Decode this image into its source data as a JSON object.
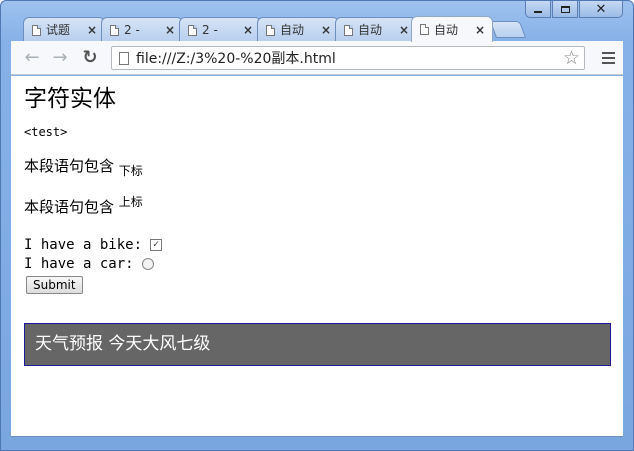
{
  "tabs": [
    {
      "title": "试题",
      "active": false
    },
    {
      "title": "2 - ",
      "active": false
    },
    {
      "title": "2 - ",
      "active": false
    },
    {
      "title": "自动",
      "active": false
    },
    {
      "title": "自动",
      "active": false
    },
    {
      "title": "自动",
      "active": true
    }
  ],
  "tab_close_glyph": "×",
  "toolbar": {
    "back_glyph": "←",
    "forward_glyph": "→",
    "reload_glyph": "↻",
    "url": "file:///Z:/3%20-%20副本.html",
    "star_glyph": "☆"
  },
  "page": {
    "heading": "字符实体",
    "entity_text": "<test>",
    "line1_text": "本段语句包含",
    "line1_sub": "下标",
    "line2_text": "本段语句包含",
    "line2_sup": "上标",
    "bike_label": "I have a bike:",
    "bike_checked": true,
    "car_label": "I have a car:",
    "submit_label": "Submit",
    "weather_text": "天气预报 今天大风七级"
  },
  "colors": {
    "weather_bg": "#666666",
    "weather_border": "#1a1a9a",
    "frame": "#86b1e8"
  }
}
